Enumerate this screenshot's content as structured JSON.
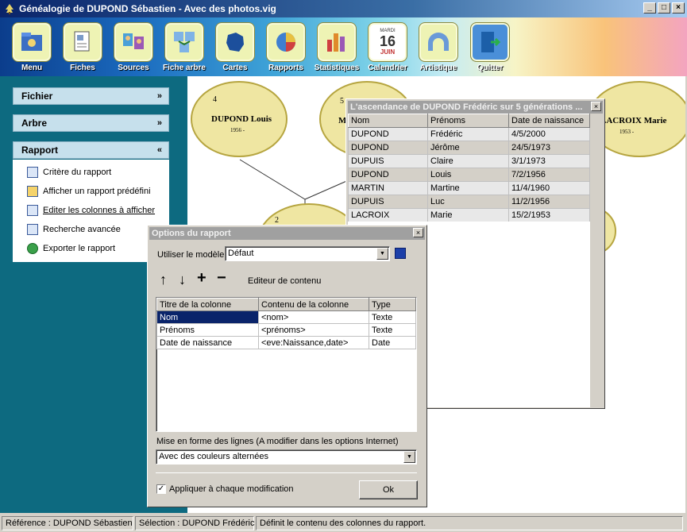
{
  "window": {
    "title": "Généalogie de DUPOND Sébastien - Avec des photos.vig",
    "minimize": "_",
    "maximize": "□",
    "close": "×"
  },
  "toolbar": [
    "Menu",
    "Fiches",
    "Sources",
    "Fiche arbre",
    "Cartes",
    "Rapports",
    "Statistiques",
    "Calendrier",
    "Artistique",
    "Quitter"
  ],
  "calendar_icon": {
    "day_name": "MARDI",
    "day": "16",
    "month": "JUIN"
  },
  "sidebar": {
    "fichier": "Fichier",
    "arbre": "Arbre",
    "rapport": "Rapport",
    "items": [
      "Critère du rapport",
      "Afficher un rapport prédéfini",
      "Editer les colonnes à afficher",
      "Recherche avancée",
      "Exporter le rapport"
    ]
  },
  "tree": {
    "node4": {
      "num": "4",
      "name": "DUPOND Louis",
      "date": "1956 -"
    },
    "node5": {
      "num": "5",
      "name": "M"
    },
    "node7": {
      "name": "LACROIX Marie",
      "date": "1953 -"
    },
    "node2": {
      "num": "2"
    }
  },
  "ascendance": {
    "title": "L'ascendance de DUPOND Frédéric sur 5 générations ...",
    "headers": [
      "Nom",
      "Prénoms",
      "Date de naissance"
    ],
    "rows": [
      [
        "DUPOND",
        "Frédéric",
        "4/5/2000"
      ],
      [
        "DUPOND",
        "Jérôme",
        "24/5/1973"
      ],
      [
        "DUPUIS",
        "Claire",
        "3/1/1973"
      ],
      [
        "DUPOND",
        "Louis",
        "7/2/1956"
      ],
      [
        "MARTIN",
        "Martine",
        "11/4/1960"
      ],
      [
        "DUPUIS",
        "Luc",
        "11/2/1956"
      ],
      [
        "LACROIX",
        "Marie",
        "15/2/1953"
      ]
    ]
  },
  "options": {
    "title": "Options du rapport",
    "model_label": "Utiliser le modèle",
    "model_value": "Défaut",
    "arrow_up": "↑",
    "arrow_down": "↓",
    "plus": "+",
    "minus": "−",
    "editor_label": "Editeur de contenu",
    "headers": [
      "Titre de la colonne",
      "Contenu de la colonne",
      "Type"
    ],
    "rows": [
      [
        "Nom",
        "<nom>",
        "Texte"
      ],
      [
        "Prénoms",
        "<prénoms>",
        "Texte"
      ],
      [
        "Date de naissance",
        "<eve:Naissance,date>",
        "Date"
      ]
    ],
    "format_label": "Mise en forme des lignes (A modifier dans les options Internet)",
    "format_value": "Avec des couleurs alternées",
    "apply_label": "Appliquer à chaque modification",
    "ok": "Ok"
  },
  "status": {
    "reference": "Référence : DUPOND Sébastien",
    "selection": "Sélection : DUPOND Frédéric",
    "hint": "Définit le contenu des colonnes du rapport."
  }
}
